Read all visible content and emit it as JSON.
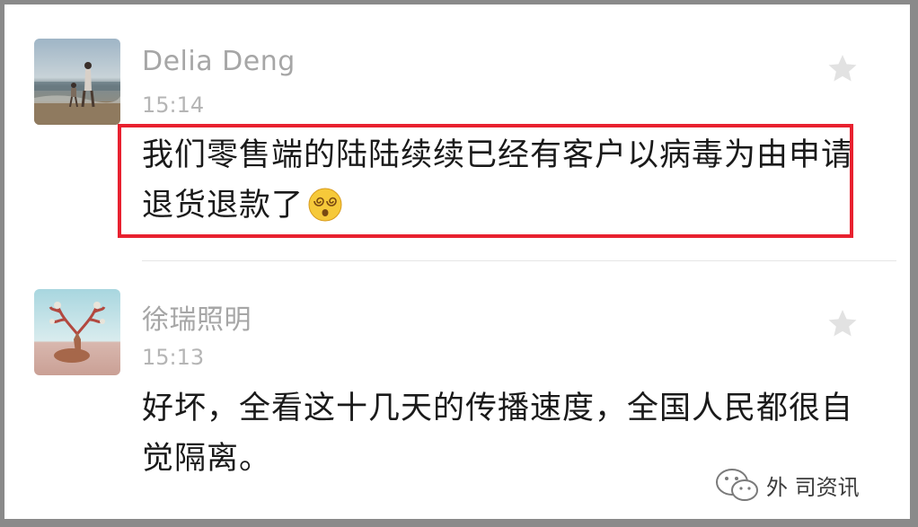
{
  "comments": [
    {
      "author": "Delia Deng",
      "time": "15:14",
      "text": "我们零售端的陆陆续续已经有客户以病毒为由申请退货退款了",
      "emoji_icon": "dizzy-face-emoji",
      "highlighted": true
    },
    {
      "author": "徐瑞照明",
      "time": "15:13",
      "text": "好坏，全看这十几天的传播速度，全国人民都很自觉隔离。"
    }
  ],
  "watermark": {
    "text": "外 司资讯",
    "icon": "wechat-logo"
  },
  "colors": {
    "highlight": "#e8212f",
    "name": "#a6a6a6",
    "text": "#1a1a1a"
  }
}
